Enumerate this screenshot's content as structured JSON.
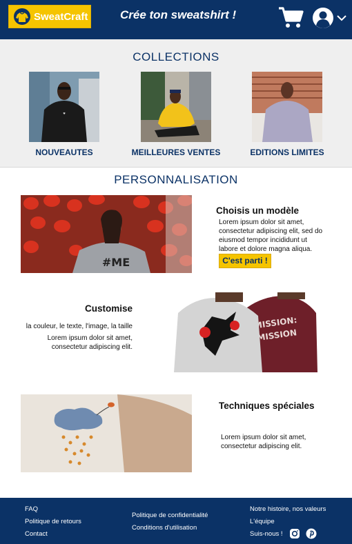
{
  "header": {
    "logo_text": "SweatCraft",
    "tagline": "Crée ton sweatshirt !"
  },
  "collections": {
    "title": "COLLECTIONS",
    "items": [
      {
        "label": "NOUVEAUTES"
      },
      {
        "label": "MEILLEURES VENTES"
      },
      {
        "label": "EDITIONS LIMITES"
      }
    ]
  },
  "personnalisation": {
    "title": "PERSONNALISATION",
    "blocks": [
      {
        "title": "Choisis un modèle",
        "text": "Lorem ipsum dolor sit amet, consectetur adipiscing elit, sed do eiusmod tempor incididunt ut labore et dolore magna aliqua.",
        "cta": "C'est parti !"
      },
      {
        "title": "Customise",
        "subtitle": "la couleur, le texte, l'image, la taille",
        "text": "Lorem ipsum dolor sit amet, consectetur adipiscing elit."
      },
      {
        "title": "Techniques spéciales",
        "text": "Lorem ipsum dolor sit amet, consectetur adipiscing elit."
      }
    ]
  },
  "footer": {
    "col1": [
      "FAQ",
      "Politique de retours",
      "Contact"
    ],
    "col2": [
      "Politique de confidentialité",
      "Conditions d'utilisation"
    ],
    "col3": [
      "Notre histoire, nos valeurs",
      "L'équipe",
      "Suis-nous !"
    ]
  },
  "colors": {
    "brand_navy": "#0b3266",
    "brand_yellow": "#f5c400"
  },
  "icons": [
    "sweatshirt-logo-icon",
    "cart-icon",
    "user-icon",
    "chevron-down-icon",
    "instagram-icon",
    "pinterest-icon"
  ]
}
